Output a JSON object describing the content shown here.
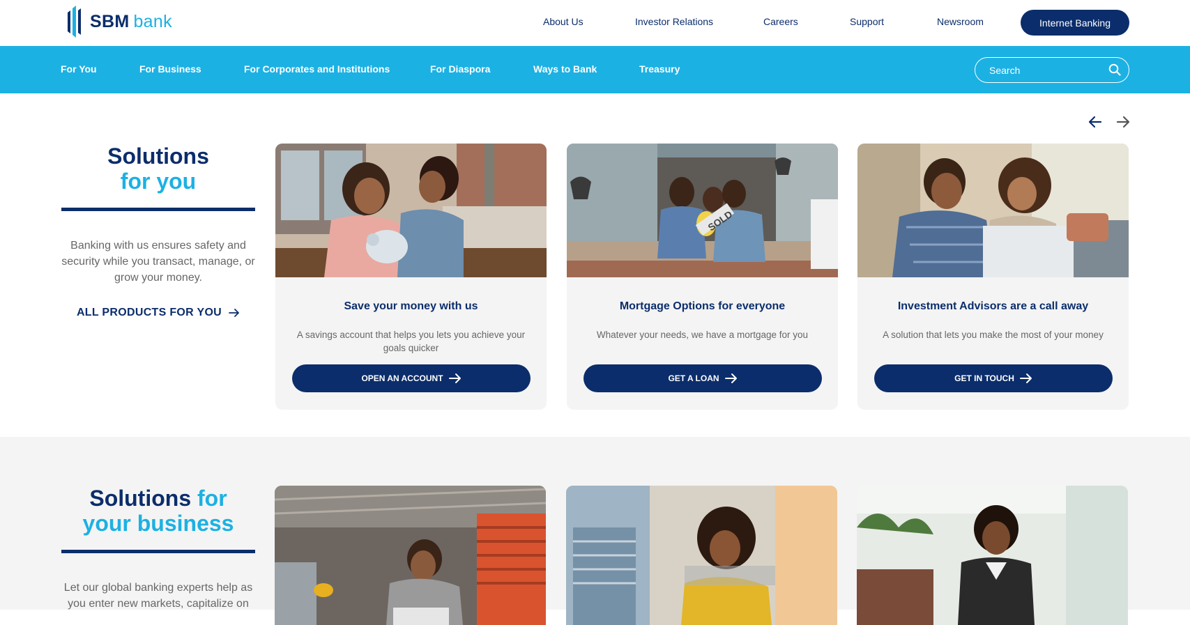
{
  "brand": {
    "name_bold": "SBM",
    "name_light": "bank"
  },
  "top_nav": {
    "items": [
      "About Us",
      "Investor Relations",
      "Careers",
      "Support",
      "Newsroom"
    ],
    "internet_banking": "Internet Banking"
  },
  "main_nav": {
    "items": [
      "For You",
      "For Business",
      "For Corporates and Institutions",
      "For Diaspora",
      "Ways to Bank",
      "Treasury"
    ],
    "search_placeholder": "Search"
  },
  "section_you": {
    "title_line1": "Solutions",
    "title_line2": "for you",
    "text": "Banking with us ensures safety and security while you transact, manage, or grow your money.",
    "link": "ALL PRODUCTS FOR YOU",
    "cards": [
      {
        "title": "Save your money with us",
        "desc": "A savings account that helps you lets you achieve your goals quicker",
        "button": "OPEN AN ACCOUNT"
      },
      {
        "title": "Mortgage Options for everyone",
        "desc": "Whatever your needs, we have a mortgage for you",
        "button": "GET A LOAN"
      },
      {
        "title": "Investment Advisors are a call away",
        "desc": "A solution that lets you make the most of your money",
        "button": "GET IN TOUCH"
      }
    ]
  },
  "section_business": {
    "title_dark": "Solutions",
    "title_light_1": "for",
    "title_light_2": "your business",
    "text": "Let our global banking experts help as you enter new markets, capitalize on"
  },
  "colors": {
    "navy": "#0b2d6b",
    "sky": "#1cb1e3",
    "card_bg": "#f4f4f4"
  }
}
